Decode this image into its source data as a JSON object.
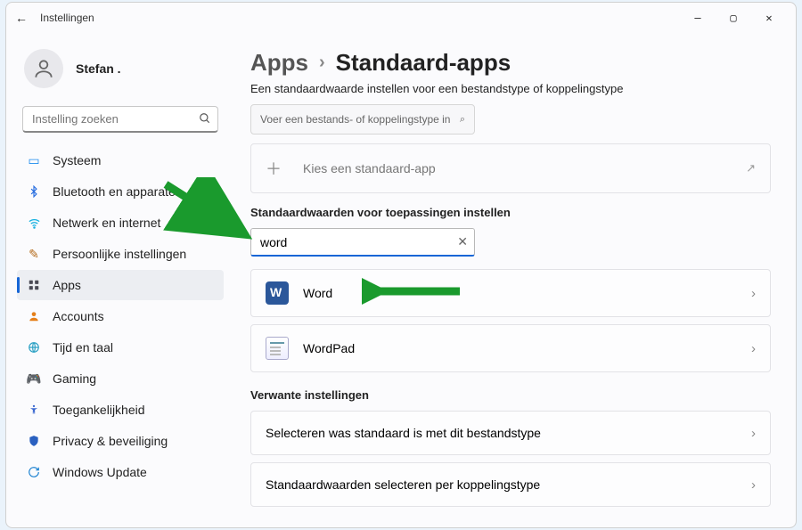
{
  "titlebar": {
    "title": "Instellingen"
  },
  "user": {
    "name": "Stefan ."
  },
  "sidebar": {
    "search_placeholder": "Instelling zoeken",
    "items": [
      {
        "label": "Systeem"
      },
      {
        "label": "Bluetooth en apparaten"
      },
      {
        "label": "Netwerk en internet"
      },
      {
        "label": "Persoonlijke instellingen"
      },
      {
        "label": "Apps"
      },
      {
        "label": "Accounts"
      },
      {
        "label": "Tijd en taal"
      },
      {
        "label": "Gaming"
      },
      {
        "label": "Toegankelijkheid"
      },
      {
        "label": "Privacy & beveiliging"
      },
      {
        "label": "Windows Update"
      }
    ]
  },
  "main": {
    "breadcrumb_parent": "Apps",
    "breadcrumb_current": "Standaard-apps",
    "subtitle": "Een standaardwaarde instellen voor een bestandstype of koppelingstype",
    "filetype_placeholder": "Voer een bestands- of koppelingstype in",
    "choose_app_label": "Kies een standaard-app",
    "apps_section_label": "Standaardwaarden voor toepassingen instellen",
    "app_search_value": "word",
    "results": [
      {
        "label": "Word"
      },
      {
        "label": "WordPad"
      }
    ],
    "related_label": "Verwante instellingen",
    "related": [
      {
        "label": "Selecteren was standaard is met dit bestandstype"
      },
      {
        "label": "Standaardwaarden selecteren per koppelingstype"
      }
    ]
  }
}
